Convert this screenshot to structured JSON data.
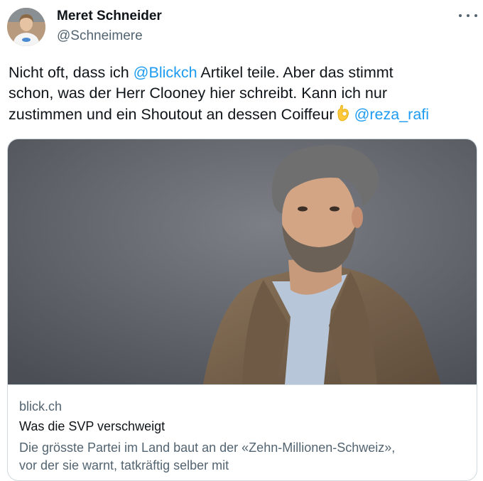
{
  "author": {
    "display_name": "Meret Schneider",
    "handle": "@Schneimere"
  },
  "tweet": {
    "line1_before": "Nicht oft, dass ich ",
    "mention1": "@Blickch",
    "line1_after": "  Artikel teile. Aber das stimmt",
    "line2": "schon, was der Herr Clooney hier schreibt. Kann ich nur",
    "line3_before": "zustimmen und ein Shoutout an dessen Coiffeur",
    "mention2": "@reza_rafi"
  },
  "link_card": {
    "domain": "blick.ch",
    "title": "Was die SVP verschweigt",
    "description_line1": "Die grösste Partei im Land baut an der «Zehn-Millionen-Schweiz»,",
    "description_line2": "vor der sie warnt, tatkräftig selber mit"
  },
  "icons": {
    "more": "more-horizontal-icon",
    "emoji": "ok-hand-icon"
  },
  "colors": {
    "link": "#1d9bf0",
    "secondary_text": "#536471",
    "primary_text": "#0f1419",
    "border": "#cfd9de"
  }
}
